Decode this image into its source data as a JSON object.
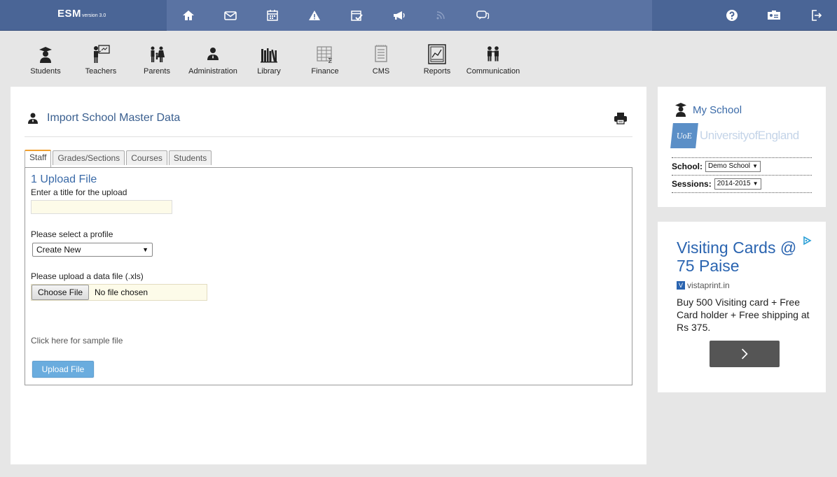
{
  "app": {
    "name": "ESM",
    "version": "version 3.0"
  },
  "topnav": [
    {
      "name": "home-icon"
    },
    {
      "name": "mail-icon"
    },
    {
      "name": "calendar-icon"
    },
    {
      "name": "alert-icon"
    },
    {
      "name": "tasks-icon"
    },
    {
      "name": "megaphone-icon"
    },
    {
      "name": "feed-icon"
    },
    {
      "name": "chat-icon"
    }
  ],
  "topright": [
    {
      "name": "help-icon"
    },
    {
      "name": "id-card-icon"
    },
    {
      "name": "logout-icon"
    }
  ],
  "modules": [
    {
      "label": "Students",
      "icon": "graduate-icon"
    },
    {
      "label": "Teachers",
      "icon": "teacher-icon"
    },
    {
      "label": "Parents",
      "icon": "parents-icon"
    },
    {
      "label": "Administration",
      "icon": "admin-icon"
    },
    {
      "label": "Library",
      "icon": "books-icon"
    },
    {
      "label": "Finance",
      "icon": "spreadsheet-icon"
    },
    {
      "label": "CMS",
      "icon": "document-icon"
    },
    {
      "label": "Reports",
      "icon": "chart-icon"
    },
    {
      "label": "Communication",
      "icon": "people-icon"
    }
  ],
  "page": {
    "title": "Import School Master Data",
    "tabs": [
      "Staff",
      "Grades/Sections",
      "Courses",
      "Students"
    ],
    "active_tab": "Staff",
    "form": {
      "section_title": "1 Upload File",
      "title_label": "Enter a title for the upload",
      "title_value": "",
      "profile_label": "Please select a profile",
      "profile_selected": "Create New",
      "file_label": "Please upload a data file  (.xls)",
      "choose_label": "Choose File",
      "file_status": "No file chosen",
      "sample_link": "Click here for sample file",
      "upload_button": "Upload File"
    }
  },
  "my_school": {
    "title": "My School",
    "logo_badge": "UoE",
    "logo_name": "UniversityofEngland",
    "school_label": "School:",
    "school_value": "Demo School",
    "session_label": "Sessions:",
    "session_value": "2014-2015"
  },
  "ad": {
    "title": "Visiting Cards @ 75 Paise",
    "site": "vistaprint.in",
    "text": "Buy 500 Visiting card + Free Card holder + Free shipping at Rs 375."
  },
  "colors": {
    "topbar": "#4a6596",
    "accent": "#3a6aa8",
    "tab_active": "#f0a030",
    "button": "#6aacde"
  }
}
